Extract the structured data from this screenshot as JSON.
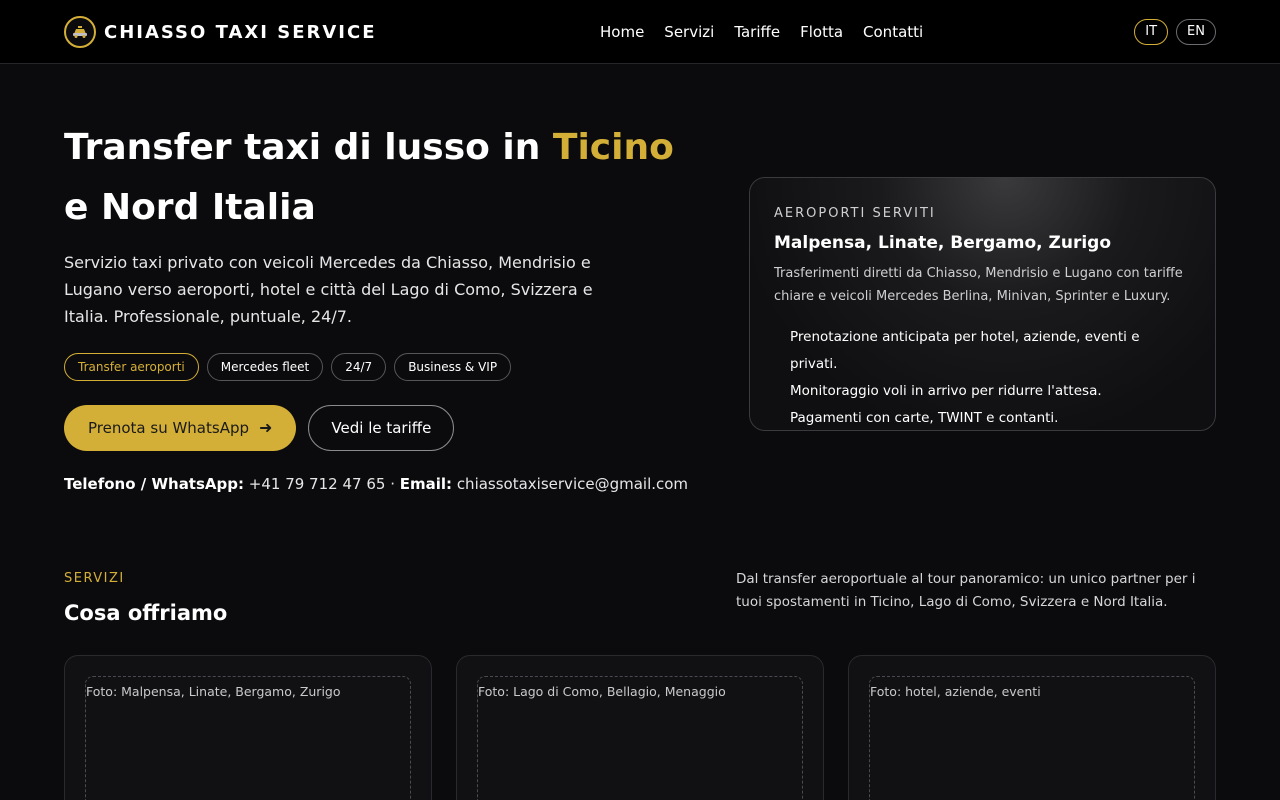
{
  "brand": {
    "name": "CHIASSO TAXI SERVICE",
    "icon": "taxi-logo-icon"
  },
  "nav": {
    "items": [
      "Home",
      "Servizi",
      "Tariffe",
      "Flotta",
      "Contatti"
    ]
  },
  "lang": {
    "it": "IT",
    "en": "EN",
    "active": "IT"
  },
  "hero": {
    "title_part1": "Transfer taxi di lusso in ",
    "title_accent": "Ticino",
    "title_part2": " e Nord Italia",
    "description": "Servizio taxi privato con veicoli Mercedes da Chiasso, Mendrisio e Lugano verso aeroporti, hotel e città del Lago di Como, Svizzera e Italia. Professionale, puntuale, 24/7.",
    "chips": [
      "Transfer aeroporti",
      "Mercedes fleet",
      "24/7",
      "Business & VIP"
    ],
    "cta_primary": "Prenota su WhatsApp",
    "cta_secondary": "Vedi le tariffe",
    "phone_label": "Telefono / WhatsApp:",
    "phone": "+41 79 712 47 65",
    "separator": "·",
    "email_label": "Email:",
    "email": "chiassotaxiservice@gmail.com"
  },
  "airport_card": {
    "eyebrow": "AEROPORTI SERVITI",
    "title": "Malpensa, Linate, Bergamo, Zurigo",
    "description": "Trasferimenti diretti da Chiasso, Mendrisio e Lugano con tariffe chiare e veicoli Mercedes Berlina, Minivan, Sprinter e Luxury.",
    "items": [
      "Prenotazione anticipata per hotel, aziende, eventi e privati.",
      "Monitoraggio voli in arrivo per ridurre l'attesa.",
      "Pagamenti con carte, TWINT e contanti."
    ]
  },
  "services": {
    "eyebrow": "SERVIZI",
    "title": "Cosa offriamo",
    "description": "Dal transfer aeroportuale al tour panoramico: un unico partner per i tuoi spostamenti in Ticino, Lago di Como, Svizzera e Nord Italia.",
    "cards": [
      {
        "photo_label": "Foto: Malpensa, Linate, Bergamo, Zurigo"
      },
      {
        "photo_label": "Foto: Lago di Como, Bellagio, Menaggio"
      },
      {
        "photo_label": "Foto: hotel, aziende, eventi"
      }
    ]
  },
  "colors": {
    "accent": "#d4af37",
    "background": "#0b0b0d",
    "header": "#000000"
  }
}
